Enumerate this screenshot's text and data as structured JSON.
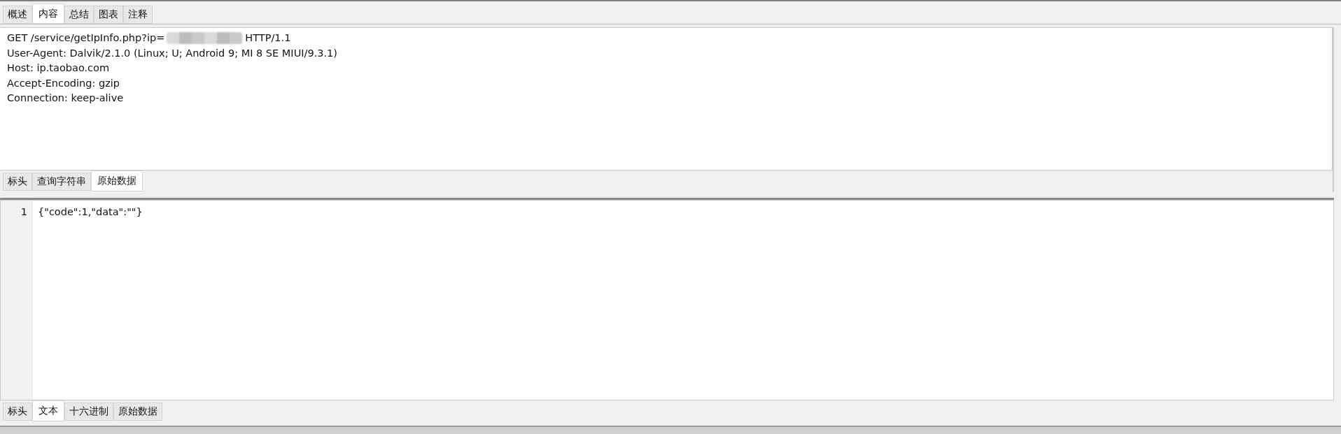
{
  "top_tabs": [
    {
      "label": "概述",
      "selected": false
    },
    {
      "label": "内容",
      "selected": true
    },
    {
      "label": "总结",
      "selected": false
    },
    {
      "label": "图表",
      "selected": false
    },
    {
      "label": "注释",
      "selected": false
    }
  ],
  "request": {
    "lines": [
      {
        "kind": "redacted",
        "before": "GET /service/getIpInfo.php?ip=",
        "after": "HTTP/1.1"
      },
      {
        "kind": "plain",
        "text": "User-Agent: Dalvik/2.1.0 (Linux; U; Android 9; MI 8 SE MIUI/9.3.1)"
      },
      {
        "kind": "plain",
        "text": "Host: ip.taobao.com"
      },
      {
        "kind": "plain",
        "text": "Accept-Encoding: gzip"
      },
      {
        "kind": "plain",
        "text": "Connection: keep-alive"
      }
    ],
    "tabs": [
      {
        "label": "标头",
        "selected": false
      },
      {
        "label": "查询字符串",
        "selected": false
      },
      {
        "label": "原始数据",
        "selected": true
      }
    ]
  },
  "response": {
    "lines": [
      {
        "number": "1",
        "text": "{\"code\":1,\"data\":\"\"}"
      }
    ],
    "tabs": [
      {
        "label": "标头",
        "selected": false
      },
      {
        "label": "文本",
        "selected": true
      },
      {
        "label": "十六进制",
        "selected": false
      },
      {
        "label": "原始数据",
        "selected": false
      }
    ]
  }
}
